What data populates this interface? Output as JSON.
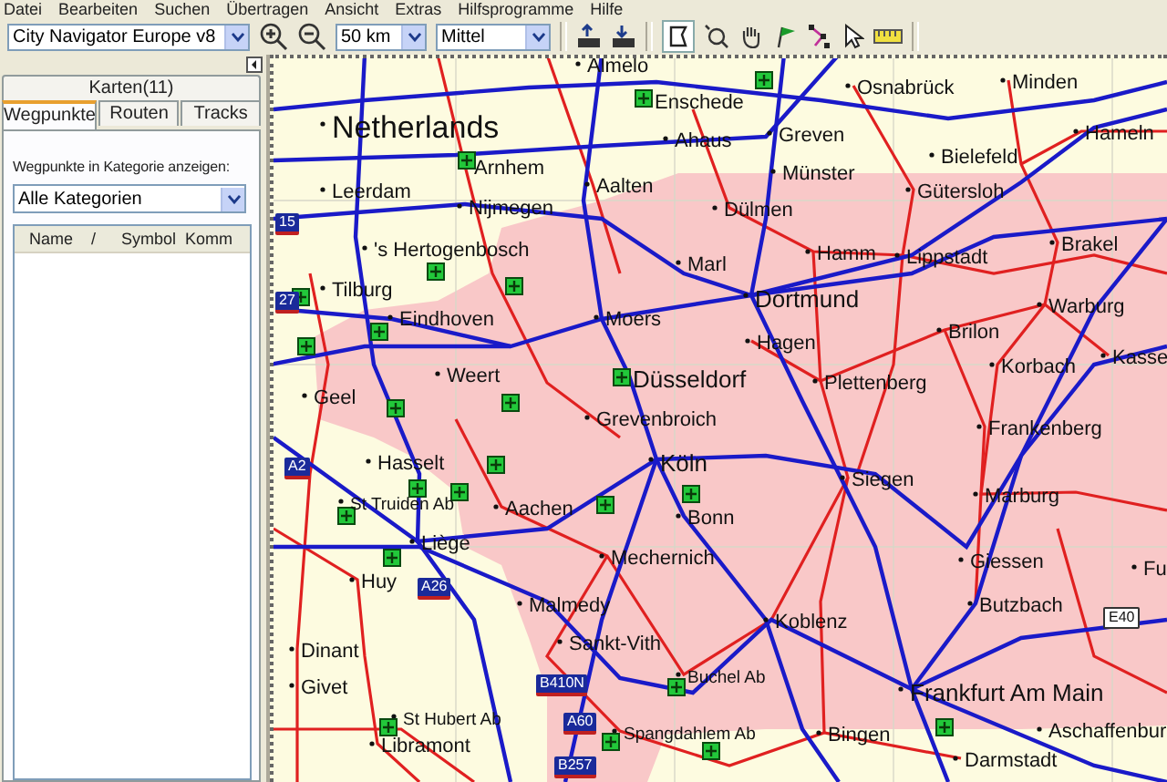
{
  "menu": [
    "Datei",
    "Bearbeiten",
    "Suchen",
    "Übertragen",
    "Ansicht",
    "Extras",
    "Hilfsprogramme",
    "Hilfe"
  ],
  "toolbar": {
    "map_product": "City Navigator Europe v8",
    "zoom_level": "50 km",
    "detail": "Mittel"
  },
  "panel": {
    "tabs": [
      {
        "label": "Karten(11)",
        "selected": false
      },
      {
        "label": "Wegpunkte",
        "selected": true
      },
      {
        "label": "Routen",
        "selected": false
      },
      {
        "label": "Tracks",
        "selected": false
      }
    ],
    "category_label": "Wegpunkte in Kategorie anzeigen:",
    "category": "Alle Kategorien",
    "columns": [
      "Name",
      "/",
      "Symbol",
      "Komm"
    ]
  },
  "map": {
    "places": [
      {
        "name": "Almelo",
        "kind": "city"
      },
      {
        "name": "Enschede",
        "kind": "city"
      },
      {
        "name": "Osnabrück",
        "kind": "city"
      },
      {
        "name": "Minden",
        "kind": "city"
      },
      {
        "name": "Netherlands",
        "kind": "country"
      },
      {
        "name": "Ahaus",
        "kind": "city"
      },
      {
        "name": "Greven",
        "kind": "city"
      },
      {
        "name": "Hameln",
        "kind": "city"
      },
      {
        "name": "Arnhem",
        "kind": "city"
      },
      {
        "name": "Münster",
        "kind": "city"
      },
      {
        "name": "Bielefeld",
        "kind": "city"
      },
      {
        "name": "Leerdam",
        "kind": "city"
      },
      {
        "name": "Aalten",
        "kind": "city"
      },
      {
        "name": "Gütersloh",
        "kind": "city"
      },
      {
        "name": "Nijmegen",
        "kind": "city"
      },
      {
        "name": "Dülmen",
        "kind": "city"
      },
      {
        "name": "'s Hertogenbosch",
        "kind": "city"
      },
      {
        "name": "Hamm",
        "kind": "city"
      },
      {
        "name": "Lippstadt",
        "kind": "city"
      },
      {
        "name": "Brakel",
        "kind": "city"
      },
      {
        "name": "Marl",
        "kind": "city"
      },
      {
        "name": "Tilburg",
        "kind": "city"
      },
      {
        "name": "Dortmund",
        "kind": "major"
      },
      {
        "name": "Warburg",
        "kind": "city"
      },
      {
        "name": "Eindhoven",
        "kind": "city"
      },
      {
        "name": "Moers",
        "kind": "city"
      },
      {
        "name": "Hagen",
        "kind": "city"
      },
      {
        "name": "Brilon",
        "kind": "city"
      },
      {
        "name": "Kasse",
        "kind": "city"
      },
      {
        "name": "Korbach",
        "kind": "city"
      },
      {
        "name": "Weert",
        "kind": "city"
      },
      {
        "name": "Düsseldorf",
        "kind": "major"
      },
      {
        "name": "Plettenberg",
        "kind": "city"
      },
      {
        "name": "Geel",
        "kind": "city"
      },
      {
        "name": "Grevenbroich",
        "kind": "city"
      },
      {
        "name": "Frankenberg",
        "kind": "city"
      },
      {
        "name": "Hasselt",
        "kind": "city"
      },
      {
        "name": "Köln",
        "kind": "major"
      },
      {
        "name": "Siegen",
        "kind": "city"
      },
      {
        "name": "St Truiden Ab",
        "kind": "small"
      },
      {
        "name": "Aachen",
        "kind": "city"
      },
      {
        "name": "Bonn",
        "kind": "city"
      },
      {
        "name": "Marburg",
        "kind": "city"
      },
      {
        "name": "Liège",
        "kind": "city"
      },
      {
        "name": "Mechernich",
        "kind": "city"
      },
      {
        "name": "Giessen",
        "kind": "city"
      },
      {
        "name": "Huy",
        "kind": "city"
      },
      {
        "name": "Fu",
        "kind": "city"
      },
      {
        "name": "Malmedy",
        "kind": "city"
      },
      {
        "name": "Butzbach",
        "kind": "city"
      },
      {
        "name": "Koblenz",
        "kind": "city"
      },
      {
        "name": "Dinant",
        "kind": "city"
      },
      {
        "name": "Sankt-Vith",
        "kind": "city"
      },
      {
        "name": "Givet",
        "kind": "city"
      },
      {
        "name": "Buchel Ab",
        "kind": "small"
      },
      {
        "name": "Frankfurt Am Main",
        "kind": "major"
      },
      {
        "name": "St Hubert Ab",
        "kind": "small"
      },
      {
        "name": "Spangdahlem Ab",
        "kind": "small"
      },
      {
        "name": "Bingen",
        "kind": "city"
      },
      {
        "name": "Aschaffenbur",
        "kind": "city"
      },
      {
        "name": "Libramont",
        "kind": "city"
      },
      {
        "name": "Darmstadt",
        "kind": "city"
      }
    ],
    "shields": [
      {
        "label": "15",
        "kind": "motorway"
      },
      {
        "label": "27",
        "kind": "motorway"
      },
      {
        "label": "A2",
        "kind": "motorway"
      },
      {
        "label": "A26",
        "kind": "motorway"
      },
      {
        "label": "E40",
        "kind": "european"
      },
      {
        "label": "B410N",
        "kind": "motorway"
      },
      {
        "label": "A60",
        "kind": "motorway"
      },
      {
        "label": "B257",
        "kind": "motorway"
      }
    ]
  }
}
